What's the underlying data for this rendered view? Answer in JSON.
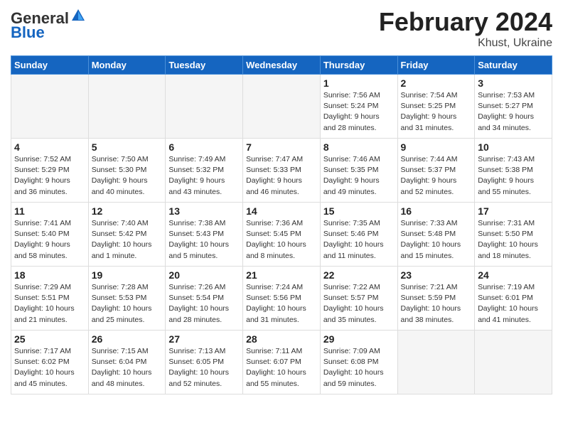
{
  "header": {
    "logo_general": "General",
    "logo_blue": "Blue",
    "title": "February 2024",
    "location": "Khust, Ukraine"
  },
  "days_of_week": [
    "Sunday",
    "Monday",
    "Tuesday",
    "Wednesday",
    "Thursday",
    "Friday",
    "Saturday"
  ],
  "weeks": [
    [
      {
        "day": "",
        "info": ""
      },
      {
        "day": "",
        "info": ""
      },
      {
        "day": "",
        "info": ""
      },
      {
        "day": "",
        "info": ""
      },
      {
        "day": "1",
        "info": "Sunrise: 7:56 AM\nSunset: 5:24 PM\nDaylight: 9 hours\nand 28 minutes."
      },
      {
        "day": "2",
        "info": "Sunrise: 7:54 AM\nSunset: 5:25 PM\nDaylight: 9 hours\nand 31 minutes."
      },
      {
        "day": "3",
        "info": "Sunrise: 7:53 AM\nSunset: 5:27 PM\nDaylight: 9 hours\nand 34 minutes."
      }
    ],
    [
      {
        "day": "4",
        "info": "Sunrise: 7:52 AM\nSunset: 5:29 PM\nDaylight: 9 hours\nand 36 minutes."
      },
      {
        "day": "5",
        "info": "Sunrise: 7:50 AM\nSunset: 5:30 PM\nDaylight: 9 hours\nand 40 minutes."
      },
      {
        "day": "6",
        "info": "Sunrise: 7:49 AM\nSunset: 5:32 PM\nDaylight: 9 hours\nand 43 minutes."
      },
      {
        "day": "7",
        "info": "Sunrise: 7:47 AM\nSunset: 5:33 PM\nDaylight: 9 hours\nand 46 minutes."
      },
      {
        "day": "8",
        "info": "Sunrise: 7:46 AM\nSunset: 5:35 PM\nDaylight: 9 hours\nand 49 minutes."
      },
      {
        "day": "9",
        "info": "Sunrise: 7:44 AM\nSunset: 5:37 PM\nDaylight: 9 hours\nand 52 minutes."
      },
      {
        "day": "10",
        "info": "Sunrise: 7:43 AM\nSunset: 5:38 PM\nDaylight: 9 hours\nand 55 minutes."
      }
    ],
    [
      {
        "day": "11",
        "info": "Sunrise: 7:41 AM\nSunset: 5:40 PM\nDaylight: 9 hours\nand 58 minutes."
      },
      {
        "day": "12",
        "info": "Sunrise: 7:40 AM\nSunset: 5:42 PM\nDaylight: 10 hours\nand 1 minute."
      },
      {
        "day": "13",
        "info": "Sunrise: 7:38 AM\nSunset: 5:43 PM\nDaylight: 10 hours\nand 5 minutes."
      },
      {
        "day": "14",
        "info": "Sunrise: 7:36 AM\nSunset: 5:45 PM\nDaylight: 10 hours\nand 8 minutes."
      },
      {
        "day": "15",
        "info": "Sunrise: 7:35 AM\nSunset: 5:46 PM\nDaylight: 10 hours\nand 11 minutes."
      },
      {
        "day": "16",
        "info": "Sunrise: 7:33 AM\nSunset: 5:48 PM\nDaylight: 10 hours\nand 15 minutes."
      },
      {
        "day": "17",
        "info": "Sunrise: 7:31 AM\nSunset: 5:50 PM\nDaylight: 10 hours\nand 18 minutes."
      }
    ],
    [
      {
        "day": "18",
        "info": "Sunrise: 7:29 AM\nSunset: 5:51 PM\nDaylight: 10 hours\nand 21 minutes."
      },
      {
        "day": "19",
        "info": "Sunrise: 7:28 AM\nSunset: 5:53 PM\nDaylight: 10 hours\nand 25 minutes."
      },
      {
        "day": "20",
        "info": "Sunrise: 7:26 AM\nSunset: 5:54 PM\nDaylight: 10 hours\nand 28 minutes."
      },
      {
        "day": "21",
        "info": "Sunrise: 7:24 AM\nSunset: 5:56 PM\nDaylight: 10 hours\nand 31 minutes."
      },
      {
        "day": "22",
        "info": "Sunrise: 7:22 AM\nSunset: 5:57 PM\nDaylight: 10 hours\nand 35 minutes."
      },
      {
        "day": "23",
        "info": "Sunrise: 7:21 AM\nSunset: 5:59 PM\nDaylight: 10 hours\nand 38 minutes."
      },
      {
        "day": "24",
        "info": "Sunrise: 7:19 AM\nSunset: 6:01 PM\nDaylight: 10 hours\nand 41 minutes."
      }
    ],
    [
      {
        "day": "25",
        "info": "Sunrise: 7:17 AM\nSunset: 6:02 PM\nDaylight: 10 hours\nand 45 minutes."
      },
      {
        "day": "26",
        "info": "Sunrise: 7:15 AM\nSunset: 6:04 PM\nDaylight: 10 hours\nand 48 minutes."
      },
      {
        "day": "27",
        "info": "Sunrise: 7:13 AM\nSunset: 6:05 PM\nDaylight: 10 hours\nand 52 minutes."
      },
      {
        "day": "28",
        "info": "Sunrise: 7:11 AM\nSunset: 6:07 PM\nDaylight: 10 hours\nand 55 minutes."
      },
      {
        "day": "29",
        "info": "Sunrise: 7:09 AM\nSunset: 6:08 PM\nDaylight: 10 hours\nand 59 minutes."
      },
      {
        "day": "",
        "info": ""
      },
      {
        "day": "",
        "info": ""
      }
    ]
  ]
}
